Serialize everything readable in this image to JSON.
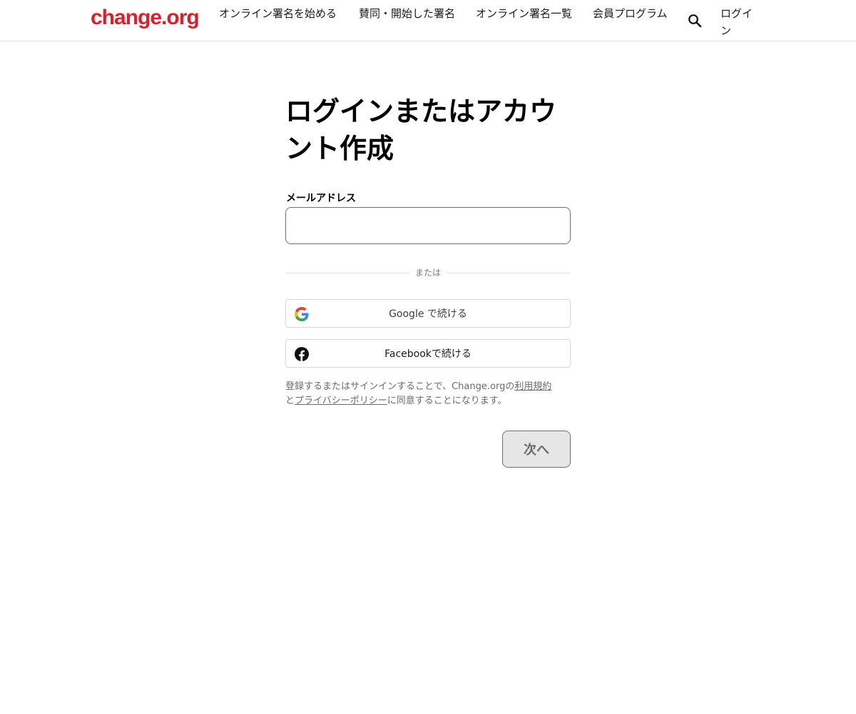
{
  "header": {
    "logo": "change.org",
    "nav": [
      {
        "label": "オンライン署名を始める"
      },
      {
        "label": "賛同・開始した署名"
      },
      {
        "label": "オンライン署名一覧"
      },
      {
        "label": "会員プログラム"
      }
    ],
    "search_icon": "search-icon",
    "login_label": "ログイン"
  },
  "main": {
    "title": "ログインまたはアカウント作成",
    "email_label": "メールアドレス",
    "email_value": "",
    "divider_text": "または",
    "google_label": "Google で続ける",
    "facebook_label": "Facebookで続ける",
    "terms": {
      "prefix": "登録するまたはサインインすることで、Change.orgの",
      "terms_link": "利用規約",
      "middle": "と",
      "privacy_link": "プライバシーポリシー",
      "suffix": "に同意することになります。"
    },
    "next_label": "次へ"
  },
  "colors": {
    "brand": "#d3242d",
    "divider": "#e0e0e0",
    "next_bg": "#e6e6e6"
  }
}
